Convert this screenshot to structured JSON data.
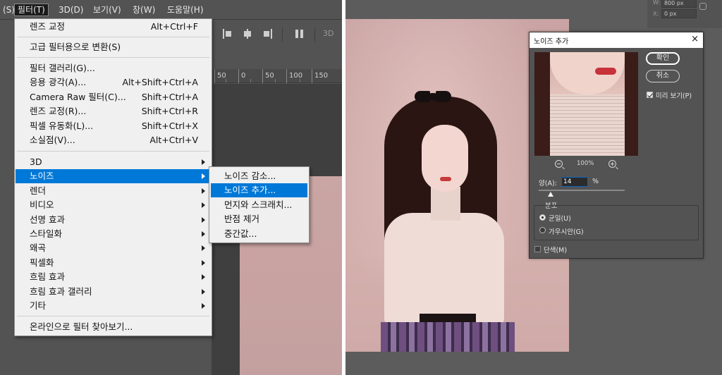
{
  "menubar": {
    "items": [
      {
        "label": "(S)"
      },
      {
        "label": "필터(T)"
      },
      {
        "label": "3D(D)"
      },
      {
        "label": "보기(V)"
      },
      {
        "label": "창(W)"
      },
      {
        "label": "도움말(H)"
      }
    ]
  },
  "options_bar": {
    "label_3d": "3D"
  },
  "ruler": {
    "ticks": [
      "50",
      "0",
      "50",
      "100",
      "150"
    ]
  },
  "filter_menu": {
    "items": [
      {
        "label": "렌즈 교정",
        "shortcut": "Alt+Ctrl+F"
      },
      {
        "label": "고급 필터용으로 변환(S)",
        "shortcut": ""
      },
      {
        "label": "필터 갤러리(G)...",
        "shortcut": ""
      },
      {
        "label": "응용 광각(A)...",
        "shortcut": "Alt+Shift+Ctrl+A"
      },
      {
        "label": "Camera Raw 필터(C)...",
        "shortcut": "Shift+Ctrl+A"
      },
      {
        "label": "렌즈 교정(R)...",
        "shortcut": "Shift+Ctrl+R"
      },
      {
        "label": "픽셀 유동화(L)...",
        "shortcut": "Shift+Ctrl+X"
      },
      {
        "label": "소실점(V)...",
        "shortcut": "Alt+Ctrl+V"
      },
      {
        "label": "3D",
        "shortcut": ""
      },
      {
        "label": "노이즈",
        "shortcut": ""
      },
      {
        "label": "렌더",
        "shortcut": ""
      },
      {
        "label": "비디오",
        "shortcut": ""
      },
      {
        "label": "선명 효과",
        "shortcut": ""
      },
      {
        "label": "스타일화",
        "shortcut": ""
      },
      {
        "label": "왜곡",
        "shortcut": ""
      },
      {
        "label": "픽셀화",
        "shortcut": ""
      },
      {
        "label": "흐림 효과",
        "shortcut": ""
      },
      {
        "label": "흐림 효과 갤러리",
        "shortcut": ""
      },
      {
        "label": "기타",
        "shortcut": ""
      },
      {
        "label": "온라인으로 필터 찾아보기...",
        "shortcut": ""
      }
    ]
  },
  "noise_submenu": {
    "items": [
      {
        "label": "노이즈 감소..."
      },
      {
        "label": "노이즈 추가..."
      },
      {
        "label": "먼지와 스크래치..."
      },
      {
        "label": "반점 제거"
      },
      {
        "label": "중간값..."
      }
    ]
  },
  "properties_fragment": {
    "w_label": "W:",
    "w_value": "800 px",
    "x_label": "X:",
    "x_value": "0 px"
  },
  "add_noise_dialog": {
    "title": "노이즈 추가",
    "close": "×",
    "ok_label": "확인",
    "cancel_label": "취소",
    "preview_label": "미리 보기(P)",
    "preview_checked": true,
    "zoom": "100%",
    "amount_label": "양(A):",
    "amount_value": "14",
    "amount_unit": "%",
    "amount_slider_percent": 14,
    "distribution_label": "분포",
    "uniform_label": "균일(U)",
    "gaussian_label": "가우시안(G)",
    "selected_distribution": "uniform",
    "monochromatic_label": "단색(M)",
    "monochromatic_checked": false
  },
  "colors": {
    "ps_dark": "#535353",
    "menu_bg": "#f0f0f0",
    "highlight": "#0078d7"
  }
}
